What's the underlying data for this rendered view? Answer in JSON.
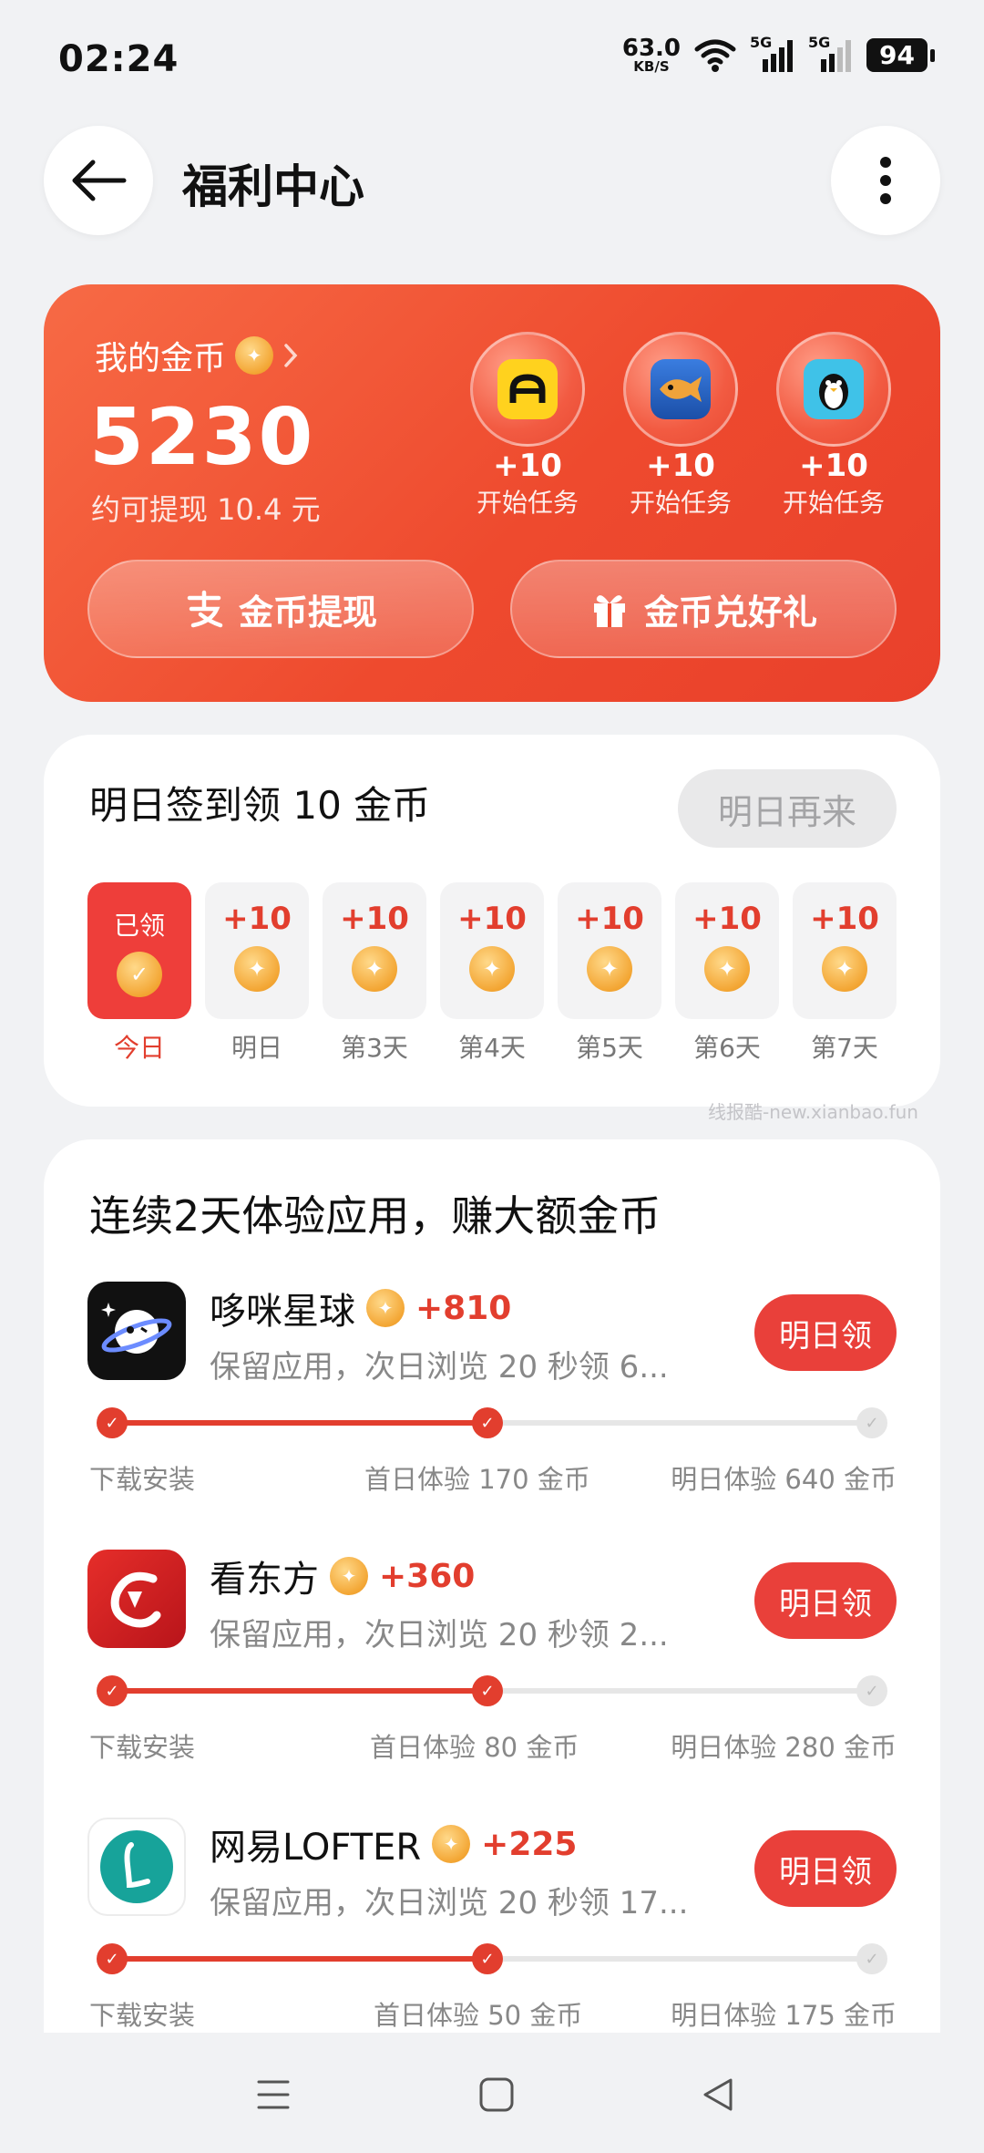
{
  "status_bar": {
    "time": "02:24",
    "net_speed": "63.0",
    "net_unit": "KB/S",
    "net1": "5G",
    "net2": "5G",
    "battery": "94"
  },
  "header": {
    "title": "福利中心"
  },
  "coin_card": {
    "label": "我的金币",
    "value": "5230",
    "sub": "约可提现 10.4 元",
    "tasks": [
      {
        "plus": "+10",
        "label": "开始任务",
        "icon": "car-app-icon"
      },
      {
        "plus": "+10",
        "label": "开始任务",
        "icon": "fishing-game-icon"
      },
      {
        "plus": "+10",
        "label": "开始任务",
        "icon": "penguin-game-icon"
      }
    ],
    "withdraw_label": "金币提现",
    "gift_label": "金币兑好礼"
  },
  "sign_in": {
    "title": "明日签到领 10 金币",
    "button": "明日再来",
    "days": [
      {
        "amount": "已领",
        "label": "今日"
      },
      {
        "amount": "+10",
        "label": "明日"
      },
      {
        "amount": "+10",
        "label": "第3天"
      },
      {
        "amount": "+10",
        "label": "第4天"
      },
      {
        "amount": "+10",
        "label": "第5天"
      },
      {
        "amount": "+10",
        "label": "第6天"
      },
      {
        "amount": "+10",
        "label": "第7天"
      }
    ]
  },
  "watermark": "线报酷-new.xianbao.fun",
  "apps_section": {
    "title": "连续2天体验应用，赚大额金币",
    "apps": [
      {
        "name": "哆咪星球",
        "bonus": "+810",
        "desc": "保留应用，次日浏览 20 秒领 6...",
        "button": "明日领",
        "steps": [
          "下载安装",
          "首日体验 170 金币",
          "明日体验 640 金币"
        ],
        "progress": 0.5
      },
      {
        "name": "看东方",
        "bonus": "+360",
        "desc": "保留应用，次日浏览 20 秒领 2...",
        "button": "明日领",
        "steps": [
          "下载安装",
          "首日体验 80 金币",
          "明日体验 280 金币"
        ],
        "progress": 0.5
      },
      {
        "name": "网易LOFTER",
        "bonus": "+225",
        "desc": "保留应用，次日浏览 20 秒领 17...",
        "button": "明日领",
        "steps": [
          "下载安装",
          "首日体验 50 金币",
          "明日体验 175 金币"
        ],
        "progress": 0.5
      }
    ]
  },
  "colors": {
    "accent": "#e9403a",
    "card_gradient_start": "#f76a45",
    "card_gradient_end": "#e9402b",
    "coin": "#f3a634"
  }
}
